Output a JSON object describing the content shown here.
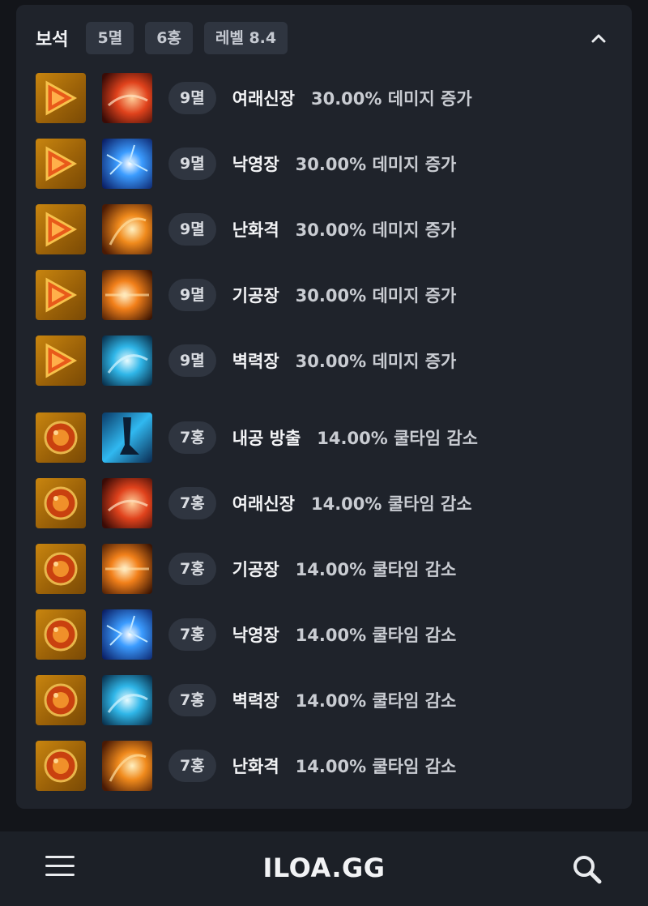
{
  "section": {
    "title": "보석",
    "chips": [
      "5멸",
      "6홍",
      "레벨 8.4"
    ],
    "collapse_icon": "chevron-up-icon"
  },
  "gems": [
    {
      "type": "멸",
      "level": "9멸",
      "skill": "여래신장",
      "effect": "30.00% 데미지 증가",
      "skill_color": "red"
    },
    {
      "type": "멸",
      "level": "9멸",
      "skill": "낙영장",
      "effect": "30.00% 데미지 증가",
      "skill_color": "blue"
    },
    {
      "type": "멸",
      "level": "9멸",
      "skill": "난화격",
      "effect": "30.00% 데미지 증가",
      "skill_color": "orange"
    },
    {
      "type": "멸",
      "level": "9멸",
      "skill": "기공장",
      "effect": "30.00% 데미지 증가",
      "skill_color": "orange"
    },
    {
      "type": "멸",
      "level": "9멸",
      "skill": "벽력장",
      "effect": "30.00% 데미지 증가",
      "skill_color": "cyan"
    },
    {
      "type": "홍",
      "level": "7홍",
      "skill": "내공 방출",
      "effect": "14.00% 쿨타임 감소",
      "skill_color": "cyan"
    },
    {
      "type": "홍",
      "level": "7홍",
      "skill": "여래신장",
      "effect": "14.00% 쿨타임 감소",
      "skill_color": "red"
    },
    {
      "type": "홍",
      "level": "7홍",
      "skill": "기공장",
      "effect": "14.00% 쿨타임 감소",
      "skill_color": "orange"
    },
    {
      "type": "홍",
      "level": "7홍",
      "skill": "낙영장",
      "effect": "14.00% 쿨타임 감소",
      "skill_color": "blue"
    },
    {
      "type": "홍",
      "level": "7홍",
      "skill": "벽력장",
      "effect": "14.00% 쿨타임 감소",
      "skill_color": "cyan"
    },
    {
      "type": "홍",
      "level": "7홍",
      "skill": "난화격",
      "effect": "14.00% 쿨타임 감소",
      "skill_color": "orange"
    }
  ],
  "bottom_nav": {
    "menu_icon": "hamburger-menu-icon",
    "logo": "ILOA.GG",
    "search_icon": "search-icon"
  },
  "colors": {
    "background": "#13151a",
    "panel": "#1f232b",
    "chip": "#2f3540",
    "gem_gold": "#c8850f"
  }
}
